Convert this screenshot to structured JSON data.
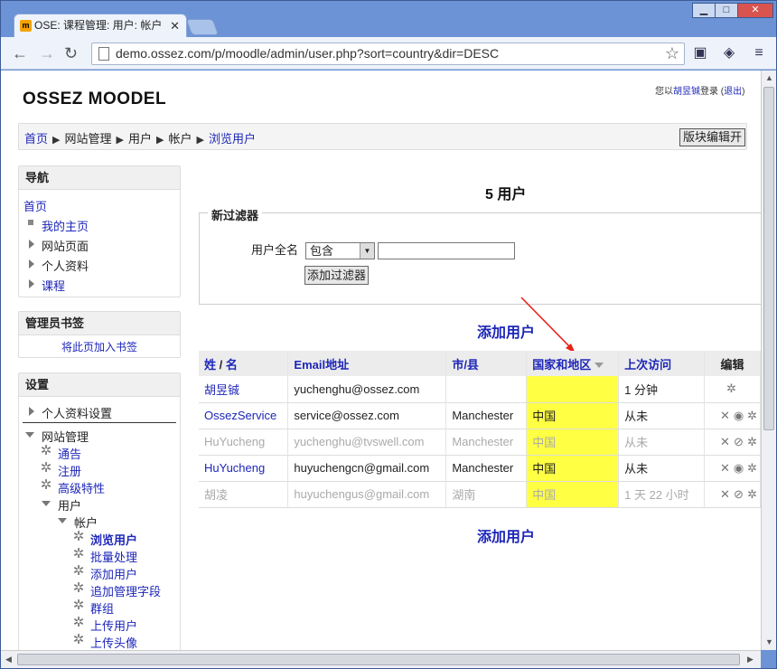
{
  "browser": {
    "tab_title": "OSE: 课程管理: 用户: 帐户",
    "tab_favicon": "m",
    "url": "demo.ossez.com/p/moodle/admin/user.php?sort=country&dir=DESC"
  },
  "page": {
    "site_title": "OSSEZ MOODEL",
    "login_prefix": "您以",
    "login_user": "胡昱铖",
    "login_mid": "登录 (",
    "logout": "退出",
    "login_suffix": ")"
  },
  "breadcrumb": {
    "items": [
      "首页",
      "网站管理",
      "用户",
      "帐户",
      "浏览用户"
    ],
    "separator": "▶",
    "block_edit_button": "版块编辑开"
  },
  "nav_block": {
    "title": "导航",
    "home": "首页",
    "my_home": "我的主页",
    "site_pages": "网站页面",
    "profile": "个人资料",
    "courses": "课程"
  },
  "bookmark_block": {
    "title": "管理员书签",
    "add_link": "将此页加入书签"
  },
  "settings_block": {
    "title": "设置",
    "profile_settings": "个人资料设置",
    "site_admin": "网站管理",
    "notifications": "通告",
    "registration": "注册",
    "advanced": "高级特性",
    "users": "用户",
    "accounts": "帐户",
    "browse_users": "浏览用户",
    "bulk": "批量处理",
    "add_user": "添加用户",
    "admin_fields": "追加管理字段",
    "cohorts": "群组",
    "upload_users": "上传用户",
    "upload_pictures": "上传头像"
  },
  "main": {
    "user_count": "5 用户",
    "filter": {
      "legend": "新过滤器",
      "field_label": "用户全名",
      "operator": "包含",
      "value": "",
      "add_button": "添加过滤器"
    },
    "add_user_link": "添加用户",
    "table": {
      "headers": {
        "lastname": "姓",
        "sep": " / ",
        "firstname": "名",
        "email": "Email地址",
        "city": "市/县",
        "country": "国家和地区",
        "lastaccess": "上次访问",
        "edit": "编辑"
      },
      "rows": [
        {
          "name": "胡昱铖",
          "email": "yuchenghu@ossez.com",
          "city": "",
          "country": "",
          "lastaccess": "1 分钟"
        },
        {
          "name": "OssezService",
          "email": "service@ossez.com",
          "city": "Manchester",
          "country": "中国",
          "lastaccess": "从未"
        },
        {
          "name": "HuYucheng",
          "email": "yuchenghu@tvswell.com",
          "city": "Manchester",
          "country": "中国",
          "lastaccess": "从未"
        },
        {
          "name": "HuYucheng",
          "email": "huyuchengcn@gmail.com",
          "city": "Manchester",
          "country": "中国",
          "lastaccess": "从未"
        },
        {
          "name": "胡凌",
          "email": "huyuchengus@gmail.com",
          "city": "湖南",
          "country": "中国",
          "lastaccess": "1 天 22 小时"
        }
      ]
    }
  },
  "colors": {
    "link": "#1d26b8",
    "highlight": "#ffff44",
    "annotation_arrow": "#e8231a"
  }
}
